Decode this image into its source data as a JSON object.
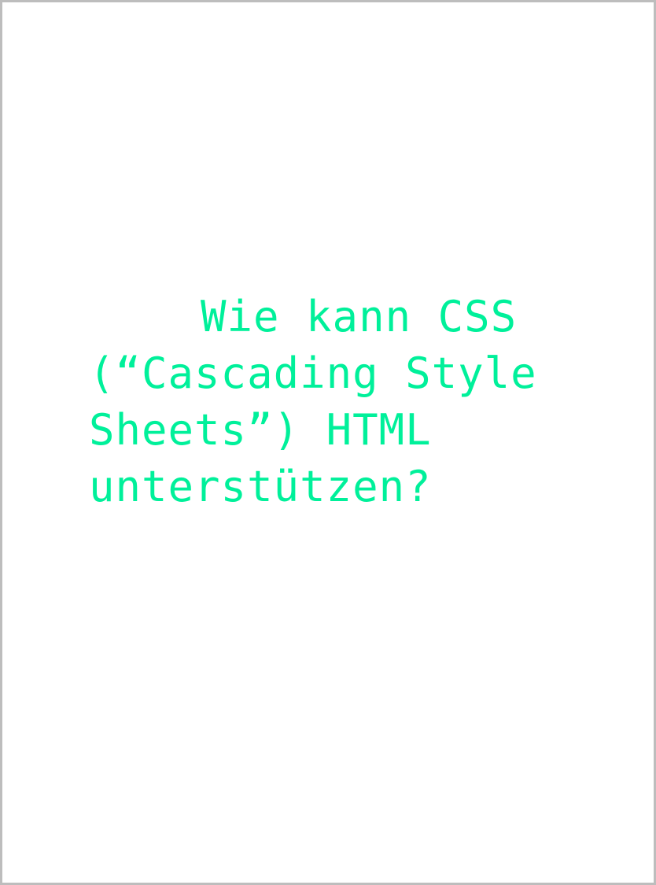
{
  "document": {
    "heading": "Wie kann CSS (“Cascading Style Sheets”) HTML unterstützen?"
  },
  "colors": {
    "text": "#00f09a",
    "border": "#bdbdbd",
    "background": "#ffffff"
  }
}
